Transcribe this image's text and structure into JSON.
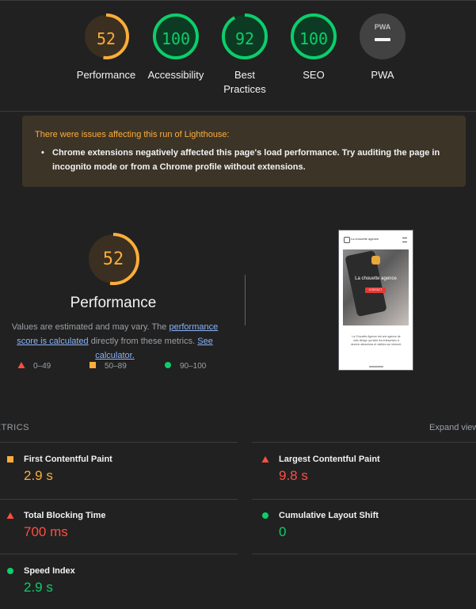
{
  "gauges": [
    {
      "value": "52",
      "label": "Performance",
      "color": "#fbad3a",
      "bg": "#3a2f20",
      "fraction": 0.52
    },
    {
      "value": "100",
      "label": "Accessibility",
      "color": "#0cce6b",
      "bg": "#0d3a23",
      "fraction": 1.0
    },
    {
      "value": "92",
      "label": "Best Practices",
      "color": "#0cce6b",
      "bg": "#0d3a23",
      "fraction": 0.92
    },
    {
      "value": "100",
      "label": "SEO",
      "color": "#0cce6b",
      "bg": "#0d3a23",
      "fraction": 1.0
    },
    {
      "value": "PWA",
      "label": "PWA",
      "color": "#f1f3f4",
      "bg": "#424242",
      "fraction": 0
    }
  ],
  "warning": {
    "title": "There were issues affecting this run of Lighthouse:",
    "item": "Chrome extensions negatively affected this page's load performance. Try auditing the page in incognito mode or from a Chrome profile without extensions."
  },
  "performance": {
    "score": "52",
    "fraction": 0.52,
    "title": "Performance",
    "desc_pre": "Values are estimated and may vary. The ",
    "link1": "performance score is calculated",
    "desc_mid": " directly from these metrics. ",
    "link2": "See calculator.",
    "legend": [
      "0–49",
      "50–89",
      "90–100"
    ]
  },
  "screenshot": {
    "site_name": "La chouette agence",
    "hero_text": "La chouette agence",
    "cta": "CONTACT",
    "body_text": "La Chouette Agence est une agence de web design qui aide les entreprises à devenir attractives et visibles sur internet."
  },
  "metrics": {
    "title": "METRICS",
    "expand": "Expand view",
    "items": [
      {
        "name": "First Contentful Paint",
        "value": "2.9 s",
        "status": "average",
        "color": "#fbad3a"
      },
      {
        "name": "Largest Contentful Paint",
        "value": "9.8 s",
        "status": "fail",
        "color": "#ff4e42"
      },
      {
        "name": "Total Blocking Time",
        "value": "700 ms",
        "status": "fail",
        "color": "#ff4e42"
      },
      {
        "name": "Cumulative Layout Shift",
        "value": "0",
        "status": "pass",
        "color": "#0cce6b"
      },
      {
        "name": "Speed Index",
        "value": "2.9 s",
        "status": "pass",
        "color": "#0cce6b"
      }
    ]
  }
}
